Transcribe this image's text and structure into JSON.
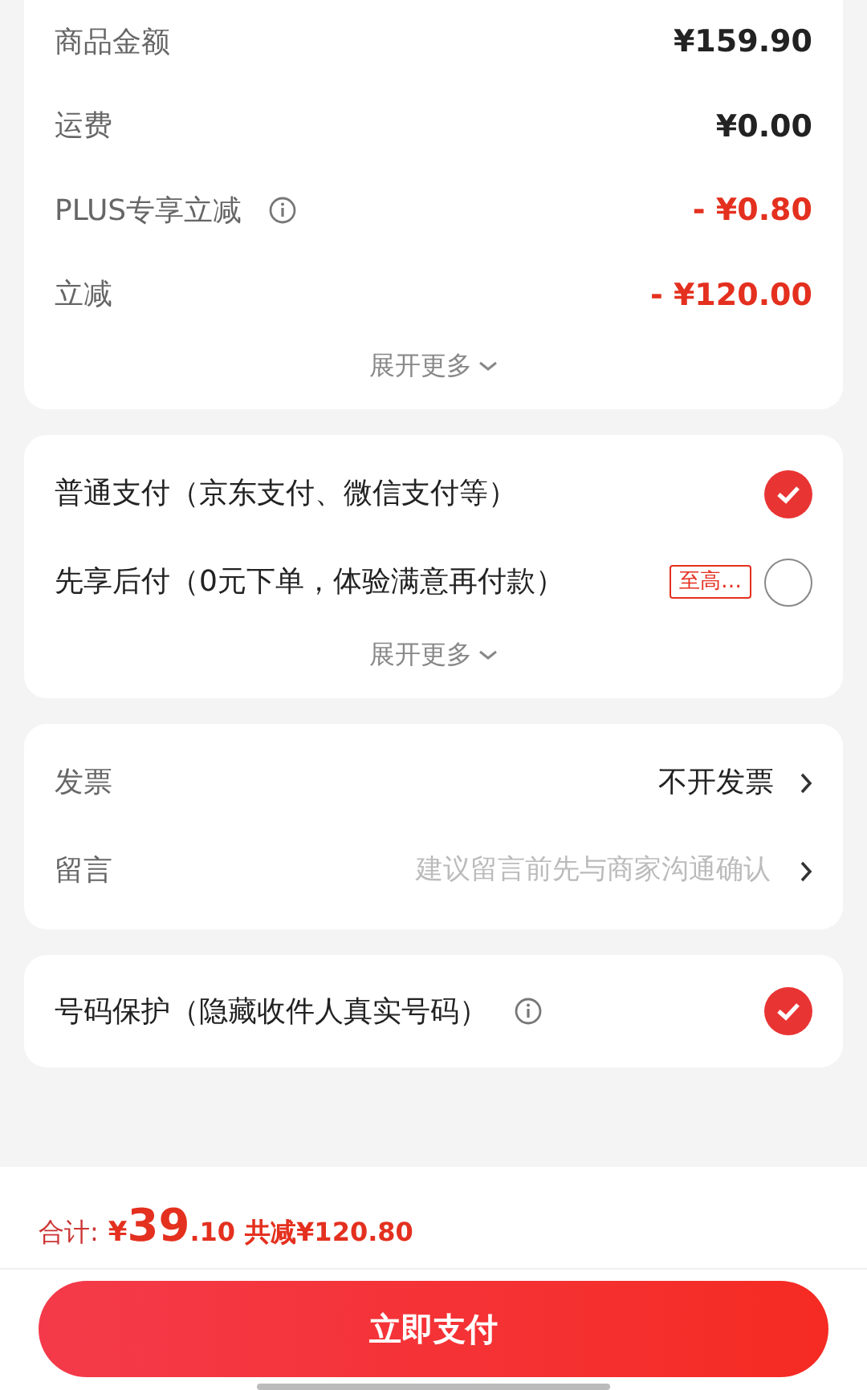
{
  "price_summary": {
    "rows": [
      {
        "label": "商品金额",
        "value": "¥159.90",
        "kind": "normal",
        "info": false
      },
      {
        "label": "运费",
        "value": "¥0.00",
        "kind": "normal",
        "info": false
      },
      {
        "label": "PLUS专享立减",
        "value": "- ¥0.80",
        "kind": "discount",
        "info": true
      },
      {
        "label": "立减",
        "value": "- ¥120.00",
        "kind": "discount",
        "info": false
      }
    ],
    "expand": "展开更多"
  },
  "payment": {
    "options": [
      {
        "label": "普通支付（京东支付、微信支付等）",
        "selected": true
      },
      {
        "label": "先享后付（0元下单，体验满意再付款）",
        "tag": "至高…",
        "selected": false
      }
    ],
    "expand": "展开更多"
  },
  "extras": [
    {
      "label": "发票",
      "value": "不开发票"
    },
    {
      "label": "留言",
      "placeholder": "建议留言前先与商家沟通确认"
    }
  ],
  "number_protection": {
    "label": "号码保护（隐藏收件人真实号码）",
    "checked": true
  },
  "footer": {
    "total_label": "合计:",
    "currency": "¥",
    "integer": "39",
    "decimal": ".10",
    "saving": "共减¥120.80",
    "pay_button": "立即支付"
  }
}
